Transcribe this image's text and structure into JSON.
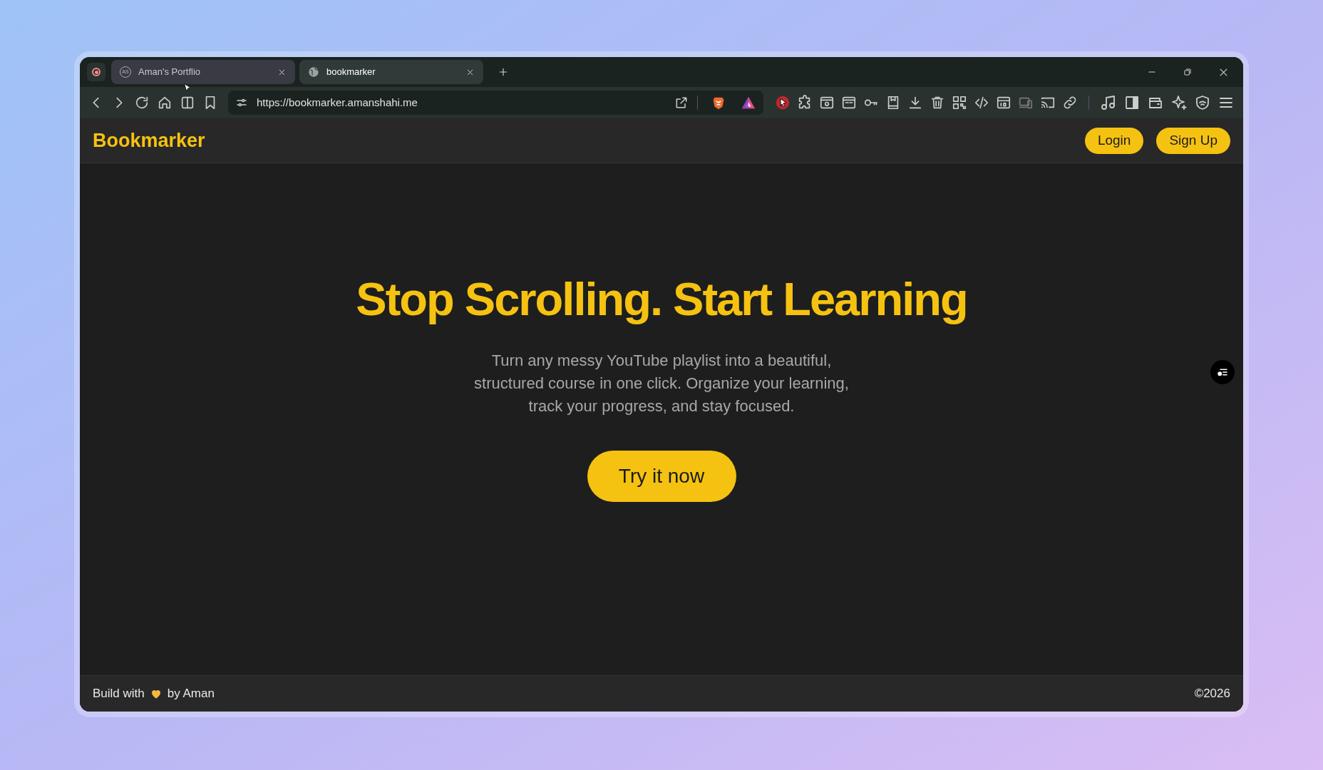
{
  "browser": {
    "tabs": [
      {
        "favicon": "AS",
        "title": "Aman's Portflio",
        "selected": false
      },
      {
        "title": "bookmarker",
        "selected": true
      }
    ],
    "url": "https://bookmarker.amanshahi.me"
  },
  "navbar": {
    "brand": "Bookmarker",
    "buttons": [
      "Login",
      "Sign Up"
    ]
  },
  "hero": {
    "heading": "Stop Scrolling. Start Learning",
    "description": "Turn any messy YouTube playlist into a beautiful, structured course in one click. Organize your learning, track your progress, and stay focused.",
    "cta": "Try it now"
  },
  "footer": {
    "left_before": "Build with",
    "left_after": "by Aman",
    "right": "©2026"
  }
}
